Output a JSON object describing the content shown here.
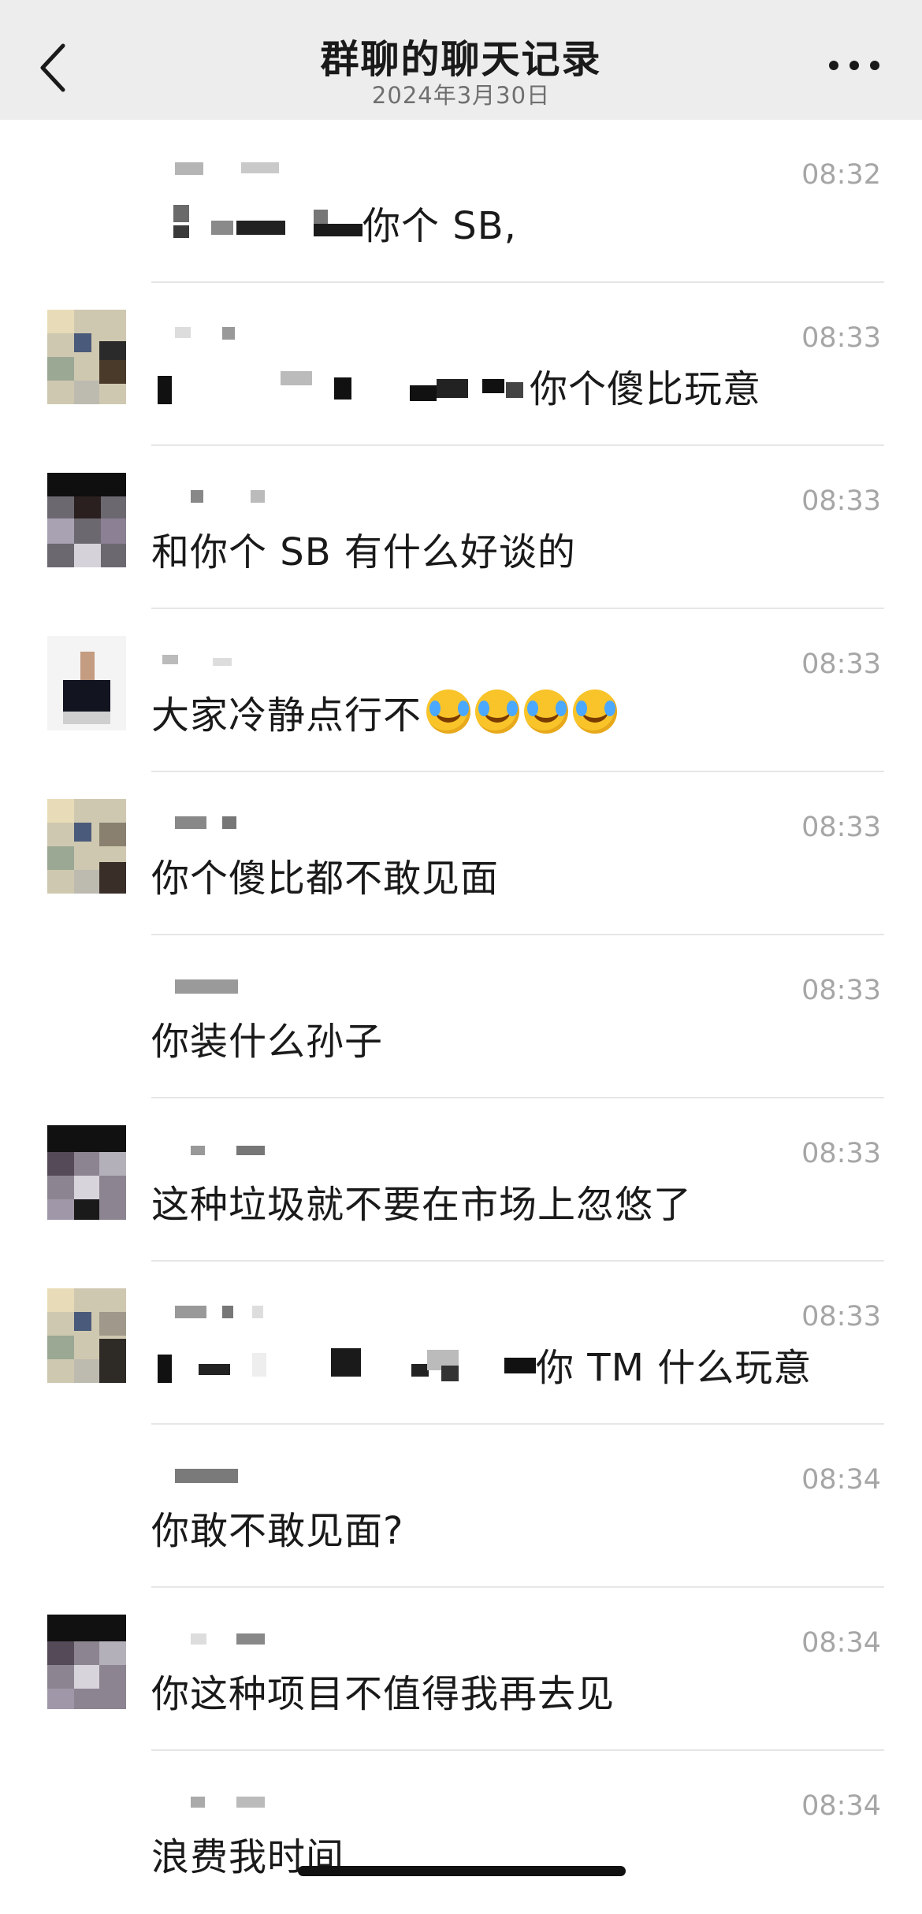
{
  "header": {
    "title": "群聊的聊天记录",
    "subtitle": "2024年3月30日",
    "back_icon": "chevron-left-icon",
    "more_icon": "more-horizontal-icon"
  },
  "messages": [
    {
      "time": "08:32",
      "text": "你个 SB,",
      "has_avatar": false
    },
    {
      "time": "08:33",
      "text": "你个傻比玩意",
      "has_avatar": true
    },
    {
      "time": "08:33",
      "text": "和你个 SB 有什么好谈的",
      "has_avatar": true
    },
    {
      "time": "08:33",
      "text": "大家冷静点行不",
      "emoji": [
        "face-with-tears-of-joy-icon",
        "face-with-tears-of-joy-icon",
        "face-with-tears-of-joy-icon",
        "face-with-tears-of-joy-icon"
      ],
      "has_avatar": true
    },
    {
      "time": "08:33",
      "text": "你个傻比都不敢见面",
      "has_avatar": true
    },
    {
      "time": "08:33",
      "text": "你装什么孙子",
      "has_avatar": false
    },
    {
      "time": "08:33",
      "text": "这种垃圾就不要在市场上忽悠了",
      "has_avatar": true
    },
    {
      "time": "08:33",
      "text": "你 TM 什么玩意",
      "has_avatar": true
    },
    {
      "time": "08:34",
      "text": "你敢不敢见面?",
      "has_avatar": false
    },
    {
      "time": "08:34",
      "text": "你这种项目不值得我再去见",
      "has_avatar": true
    },
    {
      "time": "08:34",
      "text": "浪费我时间",
      "has_avatar": false
    }
  ],
  "colors": {
    "navbar_bg": "#ededed",
    "time_text": "#a6a6a6",
    "message_text": "#1a1a1a",
    "divider": "#e6e6e6"
  }
}
